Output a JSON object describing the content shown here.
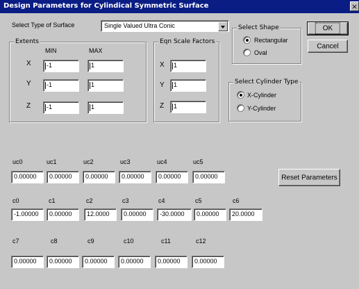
{
  "window": {
    "title": "Design Parameters for Cylindical Symmetric Surface",
    "close_glyph": "×"
  },
  "surface_type": {
    "label": "Select Type of Surface",
    "value": "Single Valued Ultra Conic"
  },
  "extents": {
    "legend": "Extents",
    "min_header": "MIN",
    "max_header": "MAX",
    "x_label": "X",
    "y_label": "Y",
    "z_label": "Z",
    "x_min": "-1",
    "x_max": "1",
    "y_min": "-1",
    "y_max": "1",
    "z_min": "-1",
    "z_max": "1"
  },
  "scale": {
    "legend": "Eqn Scale Factors",
    "x_label": "X",
    "y_label": "Y",
    "z_label": "Z",
    "x": "1",
    "y": "1",
    "z": "1"
  },
  "shape": {
    "legend": "Select Shape",
    "options": [
      "Rectangular",
      "Oval"
    ],
    "selected": "Rectangular"
  },
  "cylinder": {
    "legend": "Select Cylinder Type",
    "options": [
      "X-Cylinder",
      "Y-Cylinder"
    ],
    "selected": "X-Cylinder"
  },
  "buttons": {
    "ok": "OK",
    "cancel": "Cancel",
    "reset": "Reset Parameters"
  },
  "uc": {
    "labels": [
      "uc0",
      "uc1",
      "uc2",
      "uc3",
      "uc4",
      "uc5"
    ],
    "values": [
      "0.00000",
      "0.00000",
      "0.00000",
      "0.00000",
      "0.00000",
      "0.00000"
    ]
  },
  "c_row1": {
    "labels": [
      "c0",
      "c1",
      "c2",
      "c3",
      "c4",
      "c5",
      "c6"
    ],
    "values": [
      "-1.00000",
      "0.00000",
      "12.0000",
      "0.00000",
      "-30.0000",
      "0.00000",
      "20.0000"
    ]
  },
  "c_row2": {
    "labels": [
      "c7",
      "c8",
      "c9",
      "c10",
      "c11",
      "c12"
    ],
    "values": [
      "0.00000",
      "0.00000",
      "0.00000",
      "0.00000",
      "0.00000",
      "0.00000"
    ]
  }
}
